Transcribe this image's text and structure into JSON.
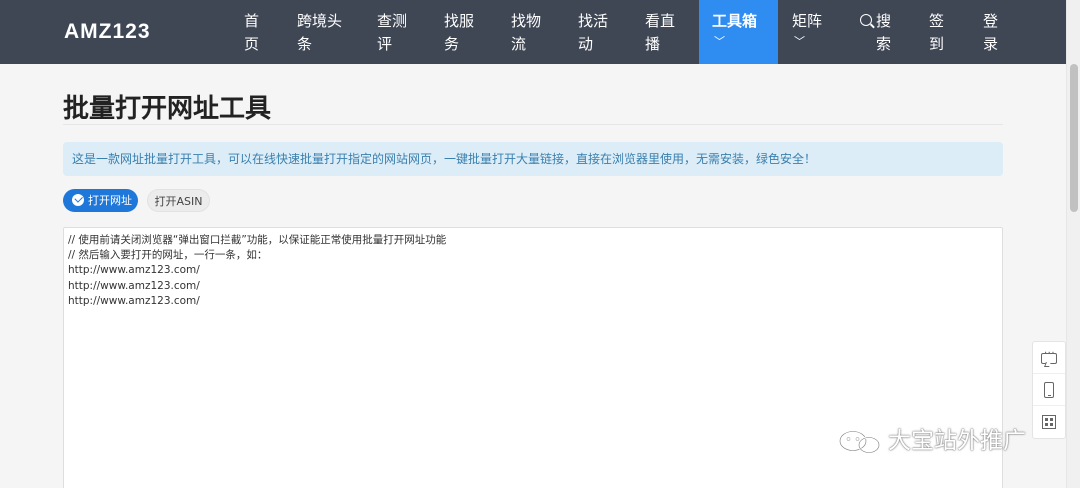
{
  "header": {
    "logo": "AMZ123",
    "nav": [
      {
        "line1": "首",
        "line2": "页"
      },
      {
        "line1": "跨境头",
        "line2": "条"
      },
      {
        "line1": "查测",
        "line2": "评"
      },
      {
        "line1": "找服",
        "line2": "务"
      },
      {
        "line1": "找物",
        "line2": "流"
      },
      {
        "line1": "找活",
        "line2": "动"
      },
      {
        "line1": "看直",
        "line2": "播"
      },
      {
        "line1": "工具箱",
        "line2": ""
      },
      {
        "line1": "矩阵",
        "line2": ""
      },
      {
        "line1": "搜",
        "line2": "索"
      },
      {
        "line1": "签",
        "line2": "到"
      },
      {
        "line1": "登",
        "line2": "录"
      }
    ],
    "active_index": 7,
    "accent_color": "#2f8cf0",
    "bg_color": "#3f4654"
  },
  "page": {
    "title": "批量打开网址工具",
    "notice": "这是一款网址批量打开工具，可以在线快速批量打开指定的网站网页，一键批量打开大量链接，直接在浏览器里使用，无需安装，绿色安全！",
    "tabs": [
      {
        "label": "打开网址",
        "selected": true
      },
      {
        "label": "打开ASIN",
        "selected": false
      }
    ],
    "textarea_value": "// 使用前请关闭浏览器“弹出窗口拦截”功能，以保证能正常使用批量打开网址功能\n// 然后输入要打开的网址，一行一条，如：\nhttp://www.amz123.com/\nhttp://www.amz123.com/\nhttp://www.amz123.com/"
  },
  "side_tools": [
    {
      "icon": "chat-icon"
    },
    {
      "icon": "phone-icon"
    },
    {
      "icon": "qrcode-icon"
    }
  ],
  "watermark": {
    "text": "大宝站外推广"
  }
}
